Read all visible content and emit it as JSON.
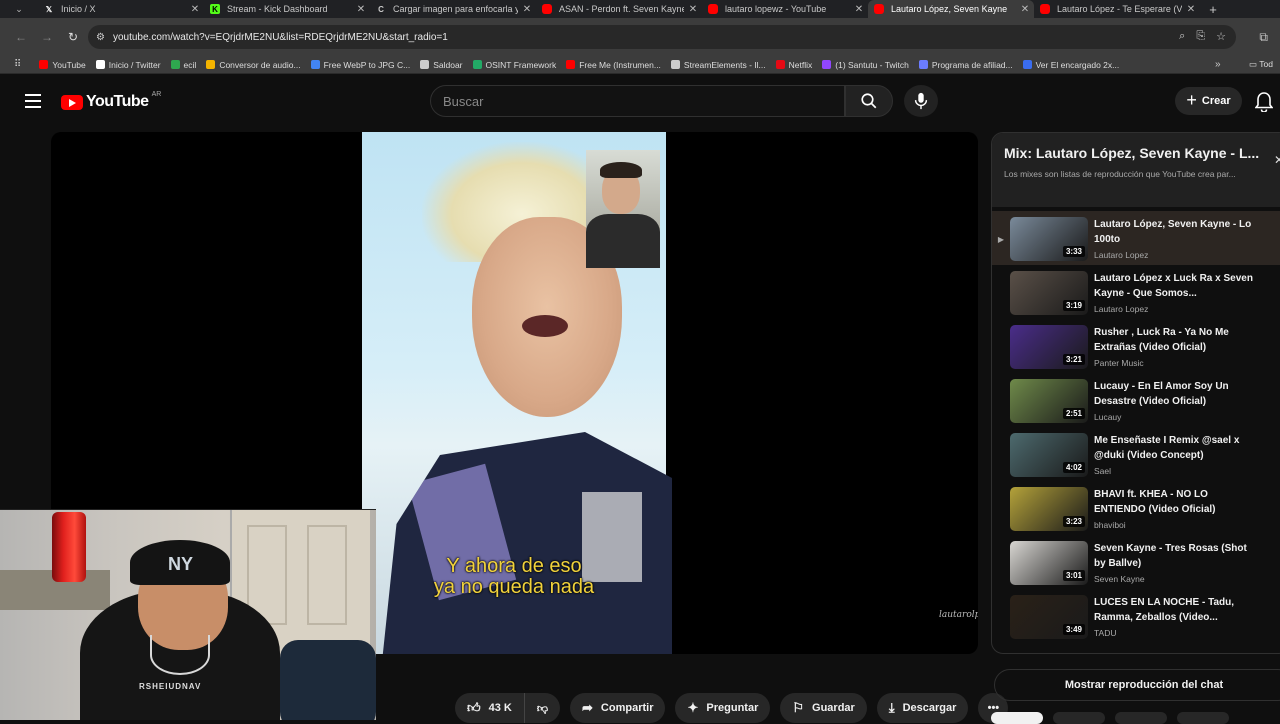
{
  "browser": {
    "tabs": [
      {
        "title": "Inicio / X",
        "icon": "x-logo-icon",
        "color": "#ffffff"
      },
      {
        "title": "Stream - Kick Dashboard",
        "icon": "kick-icon",
        "color": "#53fc18"
      },
      {
        "title": "Cargar imagen para enfocarla y",
        "icon": "loading-icon",
        "color": "#cccccc"
      },
      {
        "title": "ASAN - Perdon ft. Seven Kayne",
        "icon": "youtube-icon",
        "color": "#ff0000"
      },
      {
        "title": "lautaro lopewz - YouTube",
        "icon": "youtube-icon",
        "color": "#ff0000"
      },
      {
        "title": "Lautaro López, Seven Kayne",
        "icon": "youtube-icon",
        "color": "#ff0000",
        "active": true
      },
      {
        "title": "Lautaro López - Te Esperare (V",
        "icon": "youtube-icon",
        "color": "#ff0000"
      }
    ],
    "url": "youtube.com/watch?v=EQrjdrME2NU&list=RDEQrjdrME2NU&start_radio=1",
    "bookmarks": [
      {
        "label": "YouTube",
        "color": "#ff0000"
      },
      {
        "label": "Inicio / Twitter",
        "color": "#ffffff"
      },
      {
        "label": "ecil",
        "color": "#2fa84f"
      },
      {
        "label": "Conversor de audio...",
        "color": "#f4b400"
      },
      {
        "label": "Free WebP to JPG C...",
        "color": "#4285f4"
      },
      {
        "label": "Saldoar",
        "color": "#cccccc"
      },
      {
        "label": "OSINT Framework",
        "color": "#22aa66"
      },
      {
        "label": "Free Me (Instrumen...",
        "color": "#ff0000"
      },
      {
        "label": "StreamElements - Il...",
        "color": "#cccccc"
      },
      {
        "label": "Netflix",
        "color": "#e50914"
      },
      {
        "label": "(1) Santutu - Twitch",
        "color": "#9146ff"
      },
      {
        "label": "Programa de afiliad...",
        "color": "#6b7cff"
      },
      {
        "label": "Ver El encargado 2x...",
        "color": "#3a6df0"
      }
    ],
    "bookmarks_more": "»",
    "all_bookmarks": "Tod"
  },
  "youtube": {
    "logo_text": "YouTube",
    "country": "AR",
    "search_placeholder": "Buscar",
    "create_label": "Crear"
  },
  "video": {
    "subtitle_line1": "Y ahora de eso",
    "subtitle_line2": "ya no queda nada",
    "watermark": "lautarolpez",
    "webcam_shirt_text": "RSHEIUDNAV"
  },
  "actions": {
    "likes": "43 K",
    "share": "Compartir",
    "ask": "Preguntar",
    "save": "Guardar",
    "download": "Descargar"
  },
  "playlist": {
    "title": "Mix: Lautaro López, Seven Kayne - L...",
    "subtitle": "Los mixes son listas de reproducción que YouTube crea par...",
    "items": [
      {
        "title": "Lautaro López, Seven Kayne - Lo 100to",
        "channel": "Lautaro Lopez",
        "duration": "3:33",
        "thumb": "#7a8a9a",
        "current": true,
        "marker": "▶"
      },
      {
        "title": "Lautaro López x Luck Ra x Seven Kayne - Que Somos...",
        "channel": "Lautaro Lopez",
        "duration": "3:19",
        "thumb": "#5a5048"
      },
      {
        "title": "Rusher , Luck Ra - Ya No Me Extrañas (Video Oficial)",
        "channel": "Panter Music",
        "duration": "3:21",
        "thumb": "#4a2d8a"
      },
      {
        "title": "Lucauy - En El Amor Soy Un Desastre (Video Oficial)",
        "channel": "Lucauy",
        "duration": "2:51",
        "thumb": "#6f8a4a"
      },
      {
        "title": "Me Enseñaste I Remix @sael x @duki (Video Concept)",
        "channel": "Sael",
        "duration": "4:02",
        "thumb": "#4d6a6e"
      },
      {
        "title": "BHAVI ft. KHEA - NO LO ENTIENDO (Video Oficial)",
        "channel": "bhaviboi",
        "duration": "3:23",
        "thumb": "#b4a23a"
      },
      {
        "title": "Seven Kayne - Tres Rosas (Shot by Ballve)",
        "channel": "Seven Kayne",
        "duration": "3:01",
        "thumb": "#d8d6d2"
      },
      {
        "title": "LUCES EN LA NOCHE - Tadu, Ramma, Zeballos (Video...",
        "channel": "TADU",
        "duration": "3:49",
        "thumb": "#2a2118"
      }
    ]
  },
  "chat_button": "Mostrar reproducción del chat"
}
